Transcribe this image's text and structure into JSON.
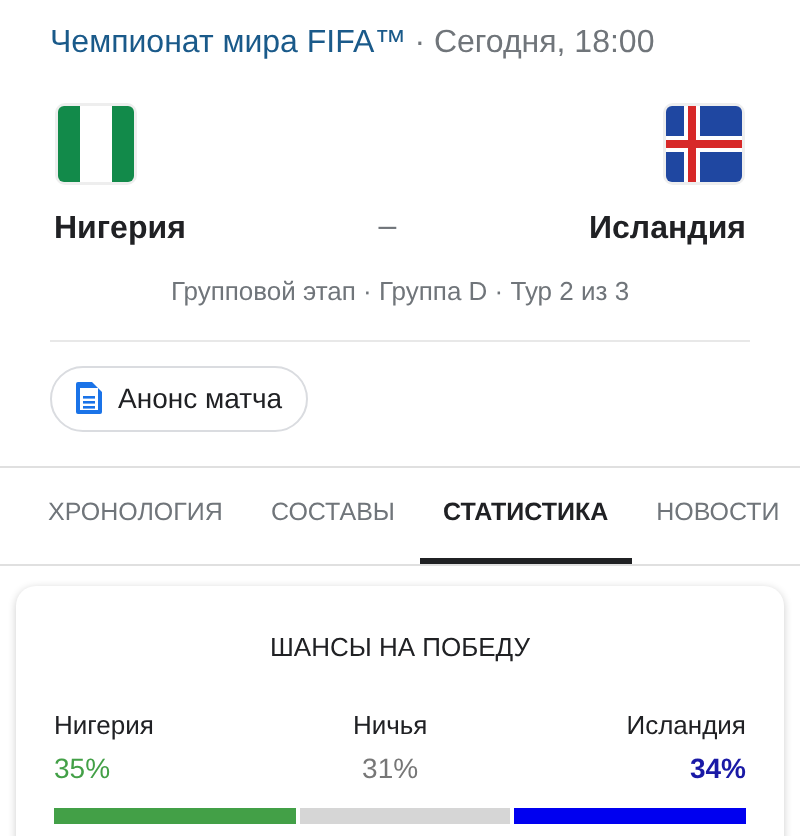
{
  "header": {
    "competition": "Чемпионат мира FIFA™",
    "time": "· Сегодня, 18:00"
  },
  "match": {
    "home": {
      "name": "Нигерия"
    },
    "separator": "–",
    "away": {
      "name": "Исландия"
    },
    "stage": "Групповой этап · Группа D · Тур 2 из 3"
  },
  "chip": {
    "label": "Анонс матча"
  },
  "tabs": [
    {
      "label": "ХРОНОЛОГИЯ",
      "selected": false
    },
    {
      "label": "СОСТАВЫ",
      "selected": false
    },
    {
      "label": "СТАТИСТИКА",
      "selected": true
    },
    {
      "label": "НОВОСТИ",
      "selected": false
    }
  ],
  "win_chances": {
    "title": "ШАНСЫ НА ПОБЕДУ",
    "outcomes": [
      {
        "kind": "home",
        "name": "Нигерия",
        "percent": "35%",
        "color": "#43a047"
      },
      {
        "kind": "draw",
        "name": "Ничья",
        "percent": "31%",
        "color": "#d6d6d6"
      },
      {
        "kind": "away",
        "name": "Исландия",
        "percent": "34%",
        "color": "#0000f0"
      }
    ]
  }
}
